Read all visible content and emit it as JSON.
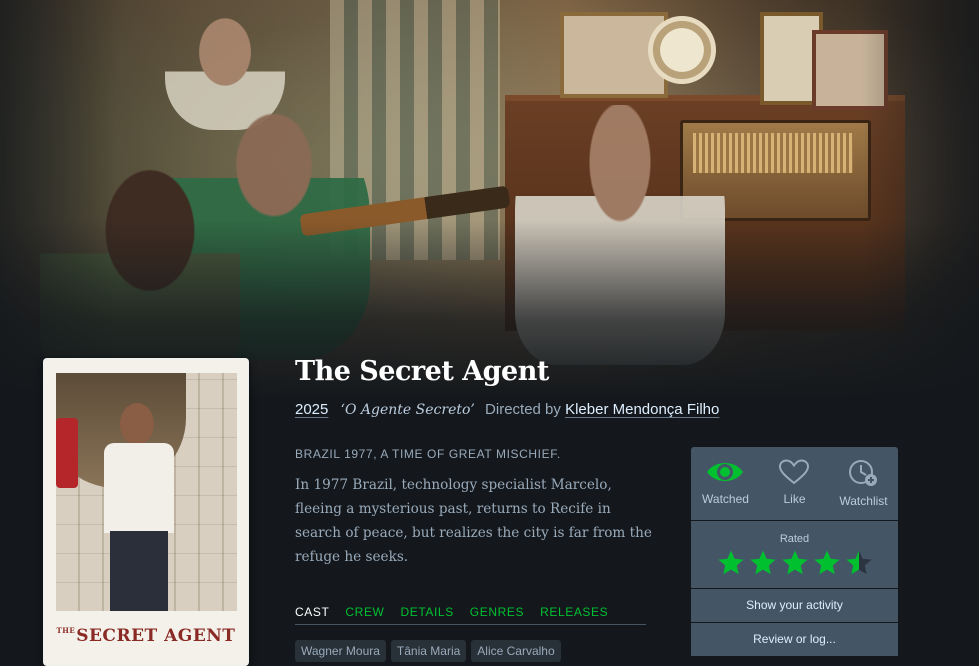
{
  "film": {
    "title": "The Secret Agent",
    "year": "2025",
    "original_title": "‘O Agente Secreto’",
    "directed_by_label": "Directed by",
    "director": "Kleber Mendonça Filho",
    "tagline": "BRAZIL 1977, A TIME OF GREAT MISCHIEF.",
    "synopsis": "In 1977 Brazil, technology specialist Marcelo, fleeing a mysterious past, returns to Recife in search of peace, but realizes the city is far from the refuge he seeks."
  },
  "poster": {
    "title_small": "THE",
    "title_main": "SECRET AGENT"
  },
  "tabs": [
    {
      "label": "CAST",
      "active": true
    },
    {
      "label": "CREW"
    },
    {
      "label": "DETAILS"
    },
    {
      "label": "GENRES"
    },
    {
      "label": "RELEASES"
    }
  ],
  "cast": [
    "Wagner Moura",
    "Tânia Maria",
    "Alice Carvalho"
  ],
  "panel": {
    "watched_label": "Watched",
    "like_label": "Like",
    "watchlist_label": "Watchlist",
    "rated_label": "Rated",
    "rating_stars": 4.5,
    "show_activity_label": "Show your activity",
    "review_label": "Review or log..."
  },
  "icons": {
    "watched": "eye-icon",
    "like": "heart-icon",
    "watchlist": "clock-plus-icon",
    "star": "star-icon"
  },
  "colors": {
    "background": "#14181c",
    "accent_green": "#00c030",
    "panel": "#445566",
    "star_green": "#00c030"
  }
}
